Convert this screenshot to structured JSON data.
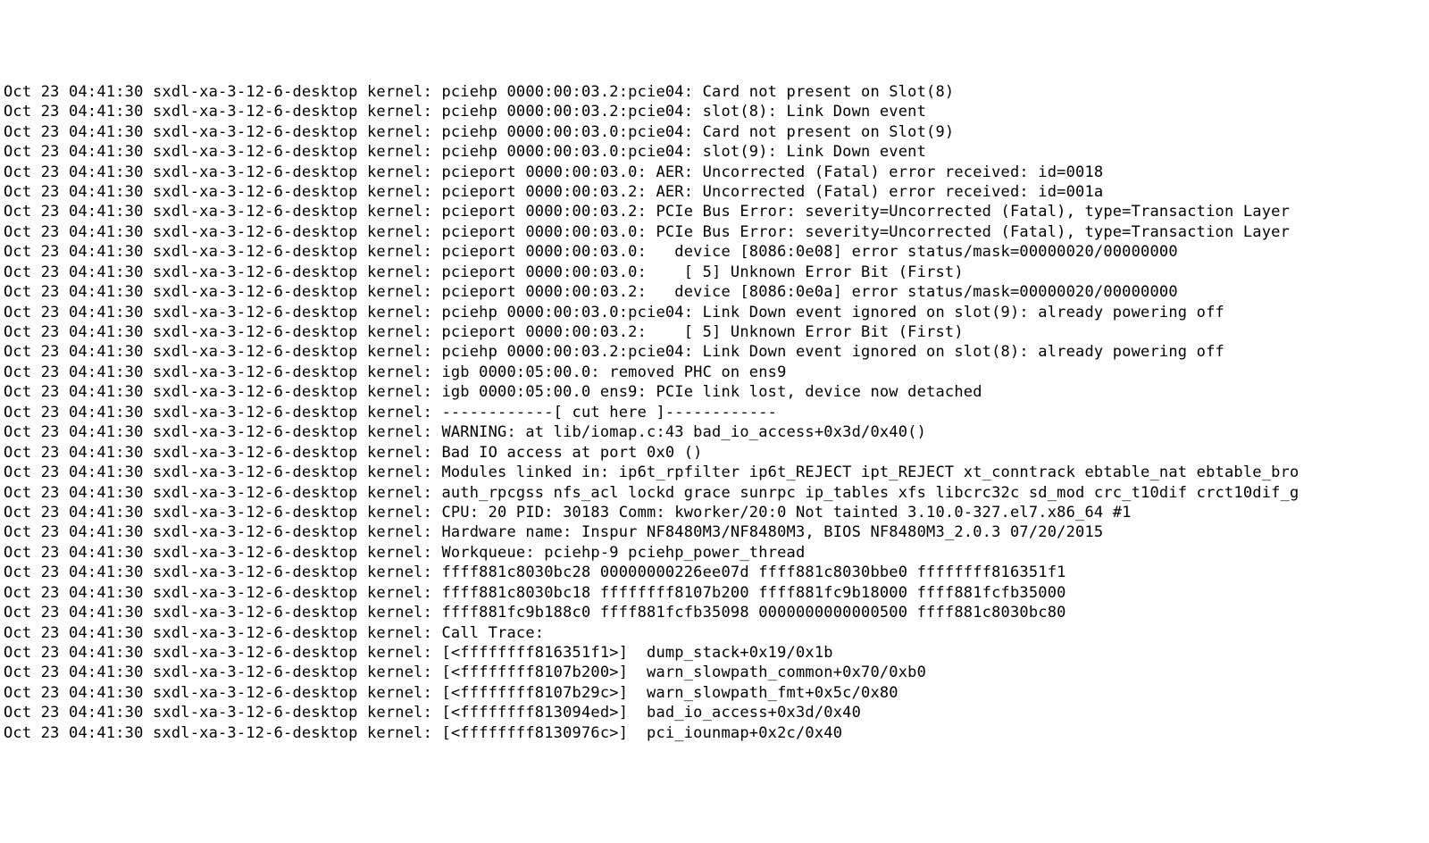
{
  "log": {
    "common_prefix": "Oct 23 04:41:30 sxdl-xa-3-12-6-desktop kernel: ",
    "lines": [
      "pciehp 0000:00:03.2:pcie04: Card not present on Slot(8)",
      "pciehp 0000:00:03.2:pcie04: slot(8): Link Down event",
      "pciehp 0000:00:03.0:pcie04: Card not present on Slot(9)",
      "pciehp 0000:00:03.0:pcie04: slot(9): Link Down event",
      "pcieport 0000:00:03.0: AER: Uncorrected (Fatal) error received: id=0018",
      "pcieport 0000:00:03.2: AER: Uncorrected (Fatal) error received: id=001a",
      "pcieport 0000:00:03.2: PCIe Bus Error: severity=Uncorrected (Fatal), type=Transaction Layer",
      "pcieport 0000:00:03.0: PCIe Bus Error: severity=Uncorrected (Fatal), type=Transaction Layer",
      "pcieport 0000:00:03.0:   device [8086:0e08] error status/mask=00000020/00000000",
      "pcieport 0000:00:03.0:    [ 5] Unknown Error Bit (First)",
      "pcieport 0000:00:03.2:   device [8086:0e0a] error status/mask=00000020/00000000",
      "pciehp 0000:00:03.0:pcie04: Link Down event ignored on slot(9): already powering off",
      "pcieport 0000:00:03.2:    [ 5] Unknown Error Bit (First)",
      "pciehp 0000:00:03.2:pcie04: Link Down event ignored on slot(8): already powering off",
      "igb 0000:05:00.0: removed PHC on ens9",
      "igb 0000:05:00.0 ens9: PCIe link lost, device now detached",
      "------------[ cut here ]------------",
      "WARNING: at lib/iomap.c:43 bad_io_access+0x3d/0x40()",
      "Bad IO access at port 0x0 ()",
      "Modules linked in: ip6t_rpfilter ip6t_REJECT ipt_REJECT xt_conntrack ebtable_nat ebtable_bro",
      "auth_rpcgss nfs_acl lockd grace sunrpc ip_tables xfs libcrc32c sd_mod crc_t10dif crct10dif_g",
      "CPU: 20 PID: 30183 Comm: kworker/20:0 Not tainted 3.10.0-327.el7.x86_64 #1",
      "Hardware name: Inspur NF8480M3/NF8480M3, BIOS NF8480M3_2.0.3 07/20/2015",
      "Workqueue: pciehp-9 pciehp_power_thread",
      "ffff881c8030bc28 00000000226ee07d ffff881c8030bbe0 ffffffff816351f1",
      "ffff881c8030bc18 ffffffff8107b200 ffff881fc9b18000 ffff881fcfb35000",
      "ffff881fc9b188c0 ffff881fcfb35098 0000000000000500 ffff881c8030bc80",
      "Call Trace:",
      "[<ffffffff816351f1>]  dump_stack+0x19/0x1b",
      "[<ffffffff8107b200>]  warn_slowpath_common+0x70/0xb0",
      "[<ffffffff8107b29c>]  warn_slowpath_fmt+0x5c/0x80",
      "[<ffffffff813094ed>]  bad_io_access+0x3d/0x40",
      "[<ffffffff8130976c>]  pci_iounmap+0x2c/0x40"
    ]
  }
}
